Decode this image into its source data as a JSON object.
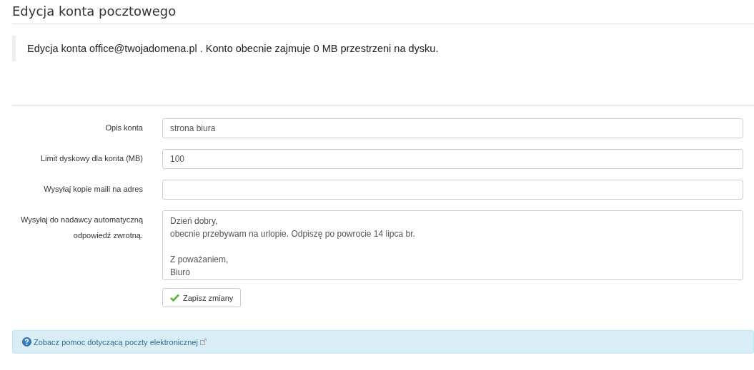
{
  "page_title": "Edycja konta pocztowego",
  "notice": "Edycja konta office@twojadomena.pl . Konto obecnie zajmuje 0 MB przestrzeni na dysku.",
  "fields": [
    {
      "kind": "input",
      "label": "Opis konta",
      "value": "strona biura"
    },
    {
      "kind": "input",
      "label": "Limit dyskowy dla konta (MB)",
      "value": "100"
    },
    {
      "kind": "input",
      "label": "Wysyłaj kopie maili na adres"
    },
    {
      "kind": "textarea",
      "label": "Wysyłaj do nadawcy automatyczną odpowiedź zwrotną.",
      "paragraphs": [
        [
          "Dzień dobry,",
          "obecnie przebywam na urlopie. Odpiszę po powrocie 14 lipca br."
        ],
        [
          "Z poważaniem,",
          "Biuro"
        ]
      ]
    }
  ],
  "save_button": "Zapisz zmiany",
  "help_link": "Zobacz pomoc dotyczącą poczty elektronicznej"
}
